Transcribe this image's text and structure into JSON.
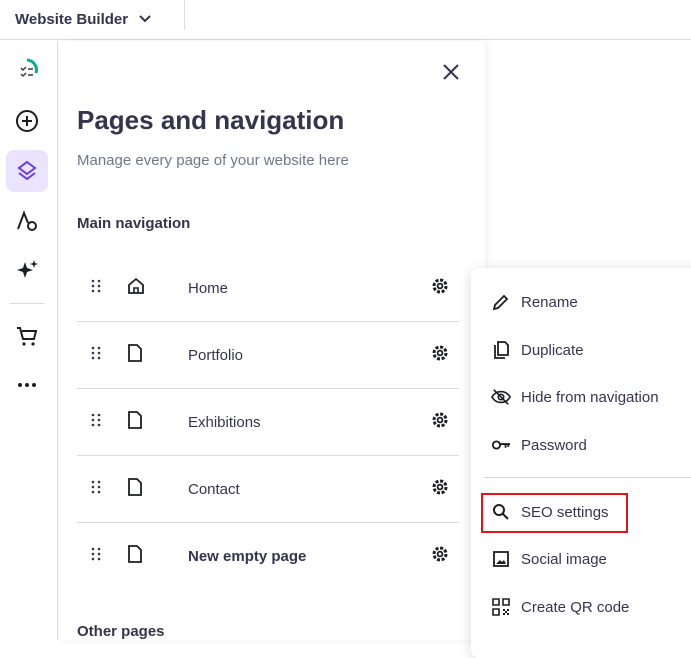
{
  "topbar": {
    "title": "Website Builder"
  },
  "panel": {
    "title": "Pages and navigation",
    "subtitle": "Manage every page of your website here",
    "main_nav_heading": "Main navigation",
    "pages": [
      {
        "label": "Home",
        "icon": "home-icon",
        "bold": false
      },
      {
        "label": "Portfolio",
        "icon": "page-icon",
        "bold": false
      },
      {
        "label": "Exhibitions",
        "icon": "page-icon",
        "bold": false
      },
      {
        "label": "Contact",
        "icon": "page-icon",
        "bold": false
      },
      {
        "label": "New empty page",
        "icon": "page-icon",
        "bold": true
      }
    ],
    "other_pages_heading": "Other pages"
  },
  "context_menu": {
    "items": [
      {
        "label": "Rename",
        "icon": "pencil-icon"
      },
      {
        "label": "Duplicate",
        "icon": "copy-icon"
      },
      {
        "label": "Hide from navigation",
        "icon": "eye-off-icon"
      },
      {
        "label": "Password",
        "icon": "key-icon"
      },
      {
        "label": "SEO settings",
        "icon": "search-icon"
      },
      {
        "label": "Social image",
        "icon": "image-icon"
      },
      {
        "label": "Create QR code",
        "icon": "qr-code-icon"
      }
    ]
  },
  "colors": {
    "accent": "#673de6",
    "accent_bg": "#ebe4ff",
    "highlight": "#e5141b",
    "progress": "#00b090"
  }
}
